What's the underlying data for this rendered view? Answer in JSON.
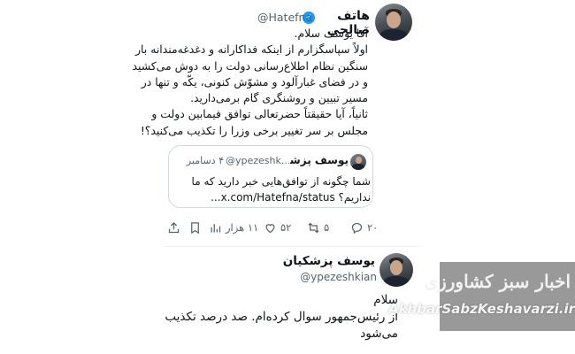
{
  "tweet": {
    "author_name": "هاتف صالحی",
    "author_handle": "@Hatefna",
    "body_lines": [
      "آقا یوسف سلام.",
      "اولاً سپاسگزارم از اینکه فداکارانه و دغدغه‌مندانه بار",
      "سنگین نظام اطلاع‌رسانی دولت را به دوش می‌کشید",
      "و در فضای غبارآلود و مشوّش کنونی، یکّه و تنها در",
      "مسیر تبیین و روشنگری گام برمی‌دارید.",
      "ثانیاً، آیا حقیقتاً حضرتعالی توافق فیمابین دولت و",
      "مجلس بر سر تغییر برخی وزرا را تکذیب می‌کنید؟!"
    ]
  },
  "quoted": {
    "author_name": "یوسف پزشکیان",
    "author_handle": "@ypezeshk...",
    "date": "۴ دسامبر",
    "body_lines": [
      "شما چگونه از توافق‌هایی خبر دارید که ما",
      "نداریم؟ x.com/Hatefna/status..."
    ]
  },
  "actions": {
    "reply_count": "۲۰",
    "retweet_count": "۵",
    "like_count": "۵۲",
    "views_count": "۱۱ هزار",
    "icons": [
      "reply-icon",
      "retweet-icon",
      "like-icon",
      "views-icon",
      "bookmark-icon",
      "share-icon"
    ]
  },
  "reply": {
    "author_name": "یوسف پزشکیان",
    "author_handle": "@ypezeshkian",
    "body_lines": [
      "سلام",
      "از رئیس‌جمهور سوال کرده‌ام. صد درصد تکذیب",
      "می‌شود"
    ]
  },
  "watermark": {
    "title": "اخبار سبز کشاورزی",
    "url": "AkhbarSabzKeshavarzi.ir"
  },
  "colors": {
    "accent": "#1d9bf0",
    "muted_text": "#536471",
    "border": "#cfd9de"
  }
}
